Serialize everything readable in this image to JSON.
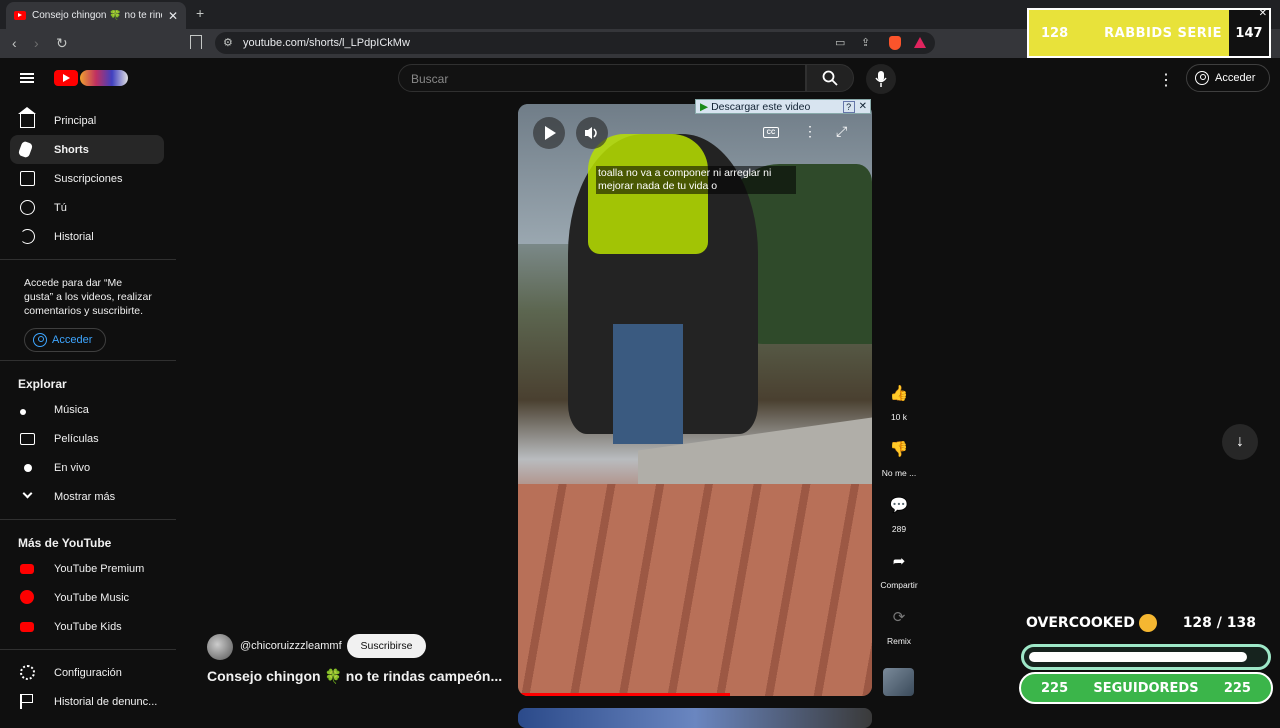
{
  "browser": {
    "tab_title": "Consejo chingon 🍀 no te rindas",
    "tab_close": "✕",
    "new_tab": "+",
    "url": "youtube.com/shorts/l_LPdpICkMw"
  },
  "overlay_top": {
    "left_num": "128",
    "label": "RABBIDS SERIE",
    "right_num": "147",
    "close": "✕"
  },
  "header": {
    "search_placeholder": "Buscar",
    "signin": "Acceder"
  },
  "sidebar": {
    "items": [
      {
        "label": "Principal",
        "icon": "home-icon"
      },
      {
        "label": "Shorts",
        "icon": "shorts-icon"
      },
      {
        "label": "Suscripciones",
        "icon": "subscriptions-icon"
      },
      {
        "label": "Tú",
        "icon": "user-icon"
      },
      {
        "label": "Historial",
        "icon": "history-icon"
      }
    ],
    "signin_note": "Accede para dar “Me gusta” a los videos, realizar comentarios y suscribirte.",
    "signin_button": "Acceder",
    "explore_title": "Explorar",
    "explore": [
      {
        "label": "Música",
        "icon": "music-icon"
      },
      {
        "label": "Películas",
        "icon": "movies-icon"
      },
      {
        "label": "En vivo",
        "icon": "live-icon"
      },
      {
        "label": "Mostrar más",
        "icon": "chevron-down-icon"
      }
    ],
    "more_title": "Más de YouTube",
    "more": [
      {
        "label": "YouTube Premium",
        "icon": "youtube-premium-icon"
      },
      {
        "label": "YouTube Music",
        "icon": "youtube-music-icon"
      },
      {
        "label": "YouTube Kids",
        "icon": "youtube-kids-icon"
      }
    ],
    "bottom": [
      {
        "label": "Configuración",
        "icon": "settings-icon"
      },
      {
        "label": "Historial de denunc...",
        "icon": "flag-icon"
      }
    ]
  },
  "video": {
    "caption": "toalla no va a componer ni arreglar ni mejorar nada de tu vida o",
    "download_bar": "Descargar este video",
    "download_help": "?",
    "download_close": "✕",
    "progress": 0.6
  },
  "actions": {
    "likes": "10 k",
    "dislike": "No me ...",
    "comments": "289",
    "share": "Compartir",
    "remix": "Remix"
  },
  "channel": {
    "handle": "@chicoruizzzleammf",
    "subscribe": "Suscribirse",
    "title": "Consejo chingon 🍀 no te rindas campeón..."
  },
  "widget": {
    "title": "OVERCOOKED",
    "count": "128   / 138",
    "progress": 0.93,
    "left": "225",
    "label": "SEGUIDOREDS",
    "right": "225"
  },
  "colors": {
    "accent": "#ff0000",
    "link": "#3ea6ff",
    "widget_green": "#3bb54a",
    "overlay_yellow": "#e8e23a"
  }
}
